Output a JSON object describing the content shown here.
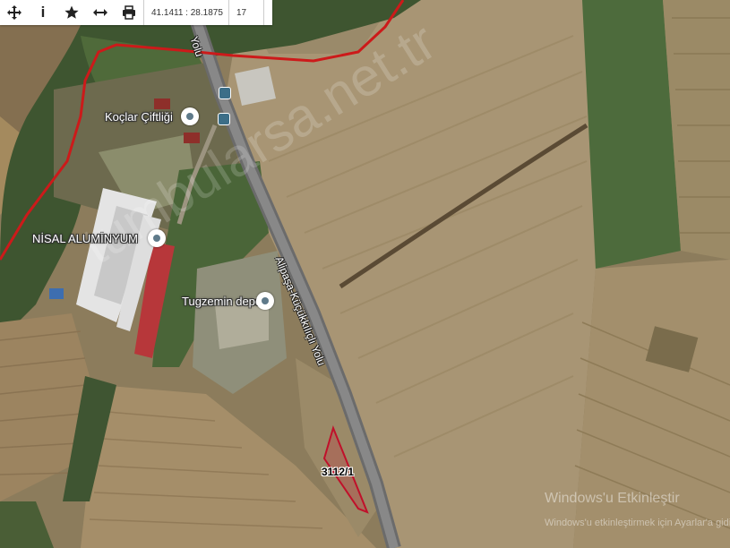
{
  "toolbar": {
    "coords": "41.1411 : 28.1875",
    "zoom": "17",
    "info_glyph": "i"
  },
  "pois": {
    "koclar": "Koçlar Çiftliği",
    "nisal": "NİSAL ALUMİNYUM",
    "tugzemin": "Tugzemin depo"
  },
  "roads": {
    "main_top": "Yolu",
    "main": "Alipaşa-Küçükkılıçlı Yolu"
  },
  "parcel": {
    "id": "3112/1",
    "outline_color": "#c0102a"
  },
  "boundary": {
    "color": "#cc1a1a"
  },
  "watermark": "tumbularsa.net.tr",
  "windows_notice": {
    "title": "Windows'u Etkinleştir",
    "subtitle": "Windows'u etkinleştirmek için Ayarlar'a gidin."
  }
}
